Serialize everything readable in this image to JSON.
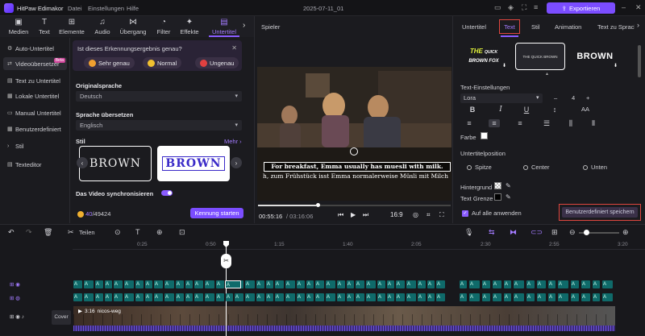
{
  "app": {
    "name": "HitPaw Edimakor",
    "menu": [
      "Datei",
      "Einstellungen",
      "Hilfe"
    ],
    "doc_title": "2025-07-11_01",
    "export_label": "Exportieren"
  },
  "toolbar": {
    "items": [
      {
        "label": "Medien",
        "icon": "media-icon"
      },
      {
        "label": "Text",
        "icon": "text-icon"
      },
      {
        "label": "Elemente",
        "icon": "elements-icon"
      },
      {
        "label": "Audio",
        "icon": "audio-icon"
      },
      {
        "label": "Übergang",
        "icon": "transition-icon"
      },
      {
        "label": "Filter",
        "icon": "filter-icon"
      },
      {
        "label": "Effekte",
        "icon": "effects-icon"
      },
      {
        "label": "Untertitel",
        "icon": "subtitle-icon"
      }
    ],
    "active": "Untertitel"
  },
  "sidebar": {
    "items": [
      {
        "label": "Auto-Untertitel"
      },
      {
        "label": "Videoübersetzer",
        "badge": "Beta"
      },
      {
        "label": "Text zu Untertitel"
      },
      {
        "label": "Lokale Untertitel"
      },
      {
        "label": "Manual Untertitel"
      },
      {
        "label": "Benutzerdefiniert"
      },
      {
        "label": "Stil"
      },
      {
        "label": "Texteditor"
      }
    ],
    "active": "Videoübersetzer"
  },
  "feedback": {
    "question": "Ist dieses Erkennungsergebnis genau?",
    "options": [
      "Sehr genau",
      "Normal",
      "Ungenau"
    ]
  },
  "translator": {
    "source_label": "Originalsprache",
    "source_value": "Deutsch",
    "target_label": "Sprache übersetzen",
    "target_value": "Englisch",
    "style_label": "Stil",
    "more_label": "Mehr",
    "style_cards": [
      "BROWN",
      "BROWN"
    ],
    "sync_label": "Das Video synchronisieren",
    "credits_used": "40",
    "credits_total": "/49424",
    "start_label": "Kennung starten"
  },
  "player": {
    "title": "Spieler",
    "subtitle_en": "For breakfast, Emma usually has muesli with milk.",
    "subtitle_de": "h, zum Frühstück isst Emma normalerweise Müsli mit Milch",
    "time_current": "00:55:16",
    "time_total": "/ 03:16:06",
    "progress": 0.3,
    "aspect": "16:9"
  },
  "right_panel": {
    "tabs": [
      "Untertitel",
      "Text",
      "Stil",
      "Animation",
      "Text zu Sprache"
    ],
    "active_tab": "Text",
    "presets": [
      {
        "line1": "THE",
        "line2": "QUICK",
        "line3": "BROWN FOX"
      },
      {
        "label": "THE QUICK BROWN"
      },
      {
        "label": "BROWN"
      }
    ],
    "text_settings_label": "Text-Einstellungen",
    "font_value": "Lora",
    "font_size": "4",
    "case_label": "AA",
    "color_label": "Farbe",
    "position_label": "Untertitelposition",
    "positions": [
      "Spitze",
      "Center",
      "Unten"
    ],
    "background_label": "Hintergrund",
    "border_label": "Text Grenze",
    "apply_all_label": "Auf alle anwenden",
    "save_custom_label": "Benutzerdefiniert speichern"
  },
  "timeline": {
    "split_label": "Teilen",
    "ruler": [
      "0:25",
      "0:50",
      "1:15",
      "1:40",
      "2:05",
      "2:30",
      "2:55",
      "3:20"
    ],
    "clip_label": "A",
    "video_clip": {
      "duration": "3:16",
      "name": "nicos-weg"
    },
    "cover_label": "Cover"
  },
  "colors": {
    "accent": "#7b4dff",
    "highlight": "#e0463f",
    "subtitle_track": "#0f6a6a"
  }
}
